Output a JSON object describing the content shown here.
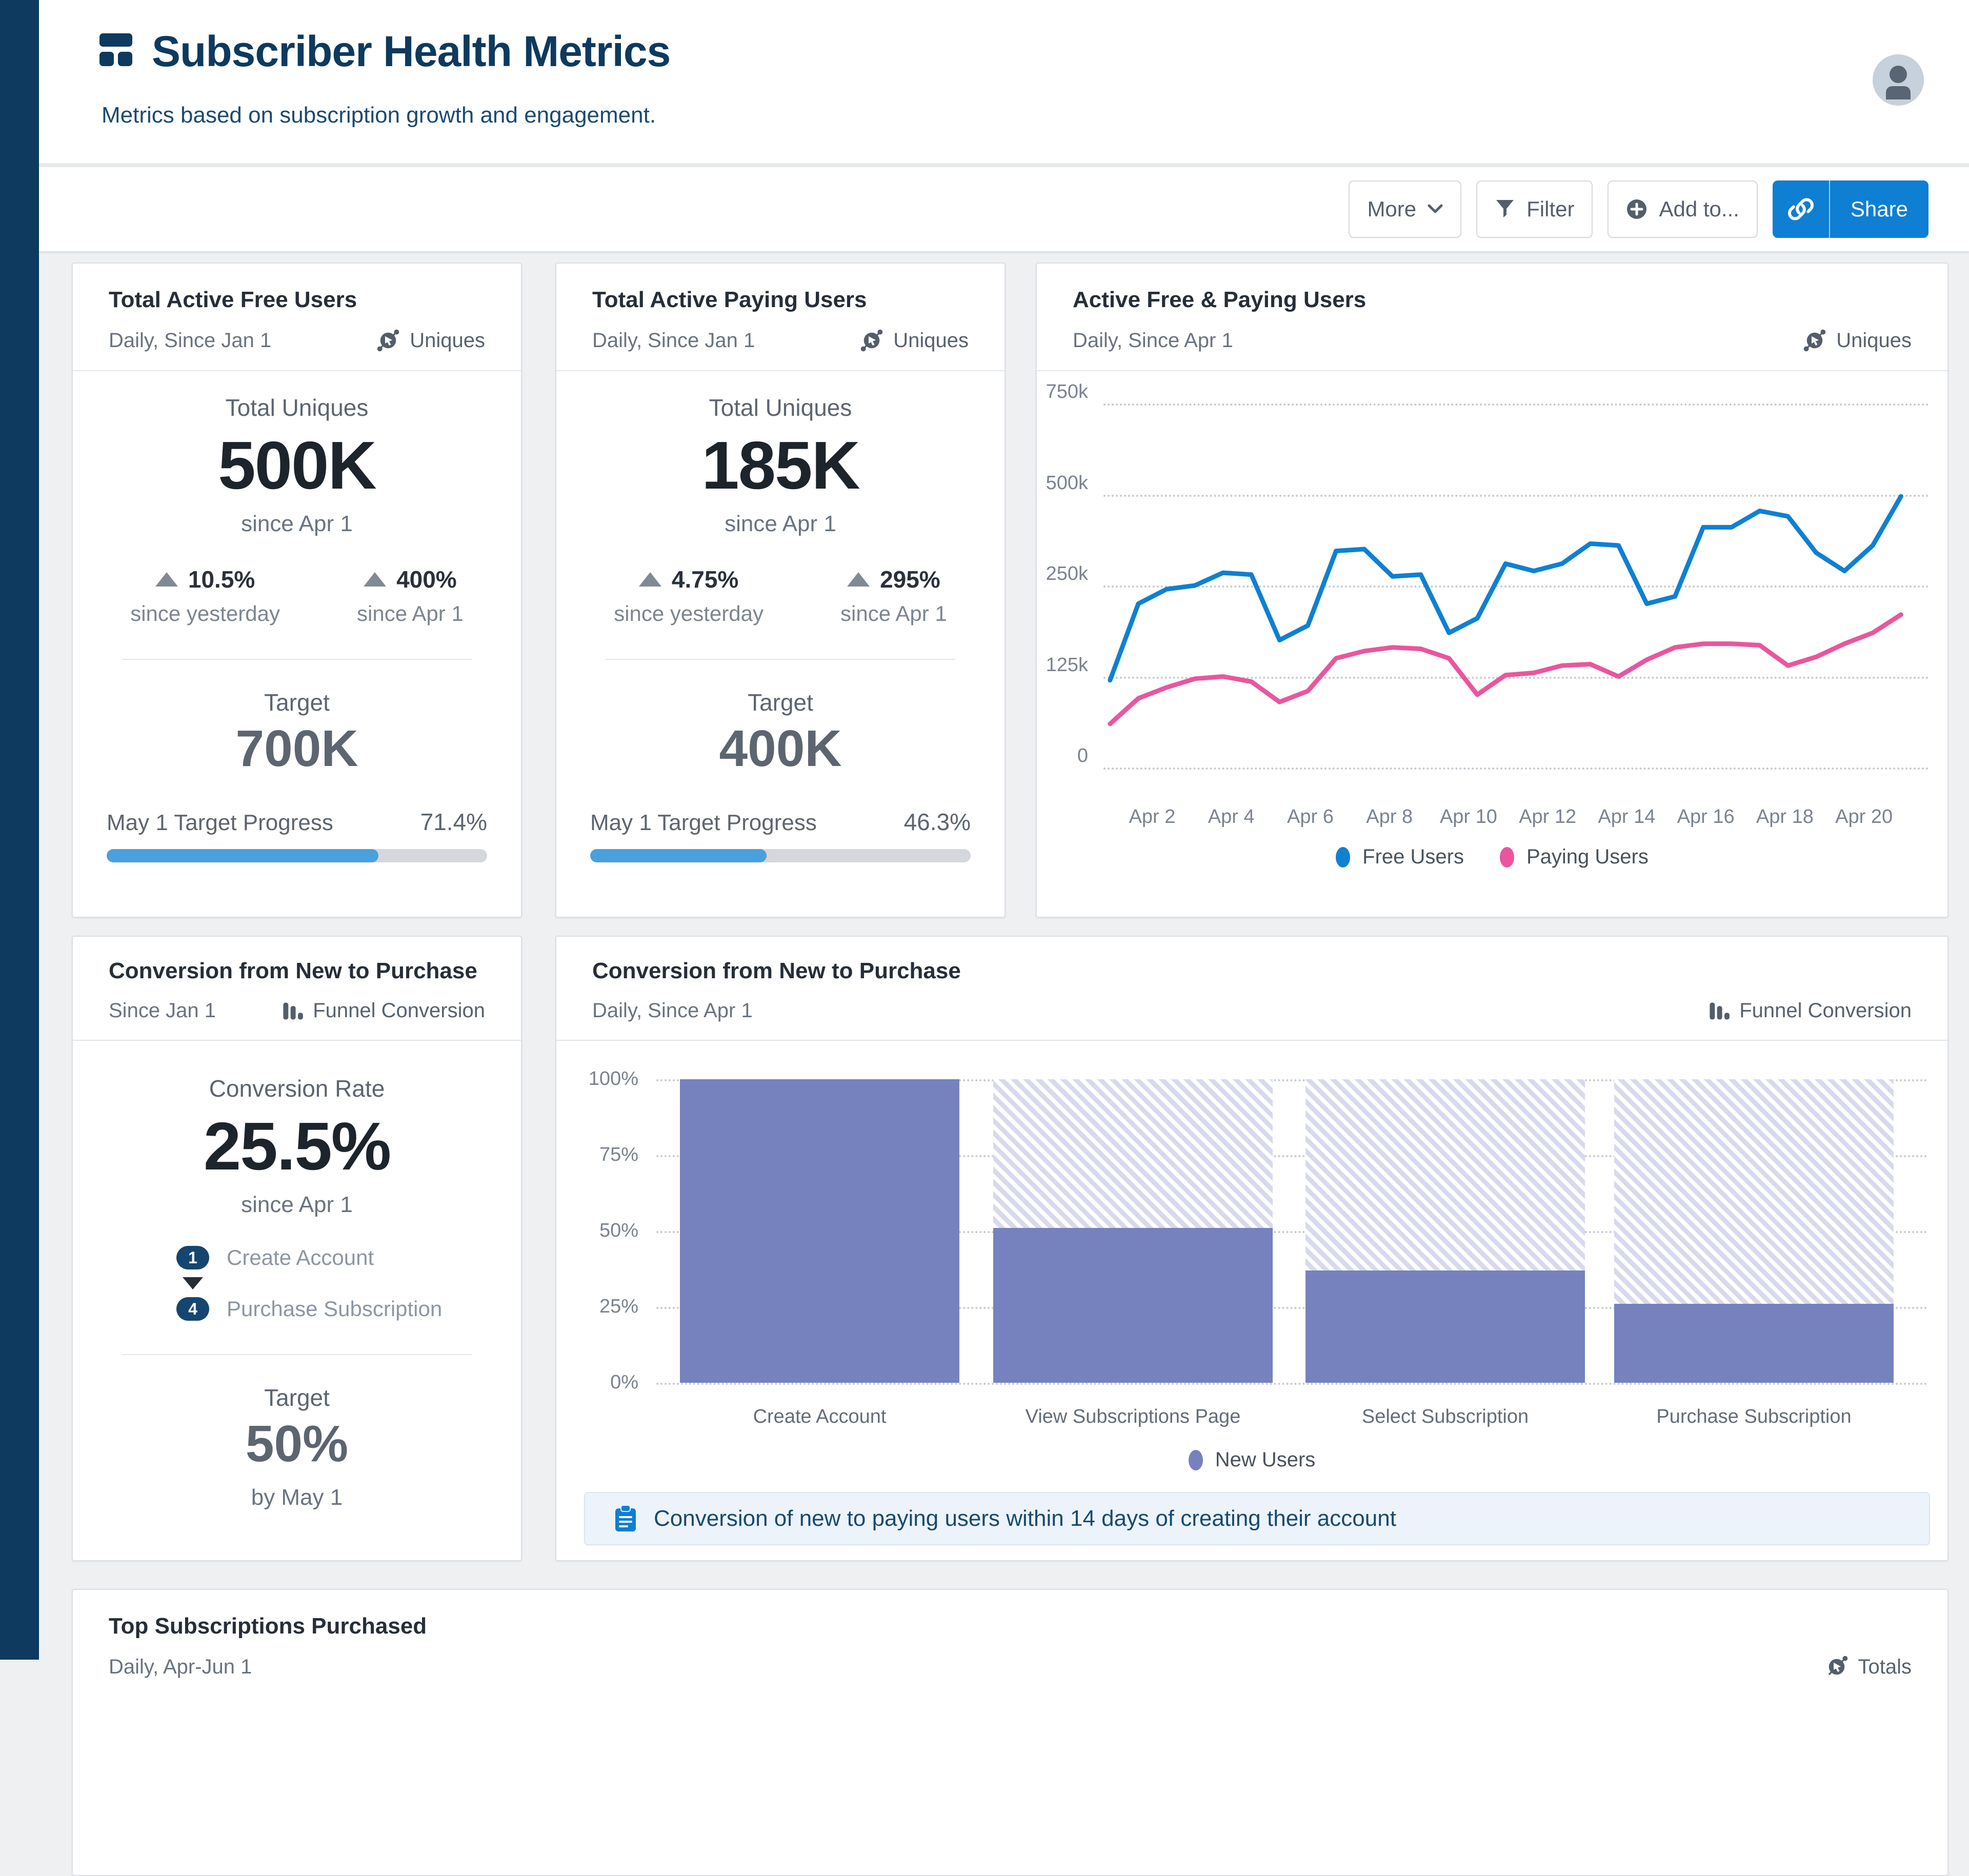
{
  "app": {
    "title": "Subscriber Health Metrics",
    "subtitle": "Metrics based on subscription growth and engagement."
  },
  "toolbar": {
    "more_label": "More",
    "filter_label": "Filter",
    "add_to_label": "Add to...",
    "share_label": "Share"
  },
  "colors": {
    "navy": "#0d3a5e",
    "accent_blue": "#0e7fd2",
    "progress_fill": "#4aa0dd",
    "line_blue": "#0f80d2",
    "line_pink": "#e9569e",
    "funnel_purple": "#7682bd"
  },
  "cards": {
    "free_users": {
      "title": "Total Active Free Users",
      "subtitle": "Daily, Since Jan 1",
      "badge": "Uniques",
      "metric_label": "Total Uniques",
      "metric_value": "500K",
      "metric_caption": "since Apr 1",
      "delta1": {
        "value": "10.5%",
        "label": "since yesterday"
      },
      "delta2": {
        "value": "400%",
        "label": "since Apr 1"
      },
      "target_label": "Target",
      "target_value": "700K",
      "progress_label": "May 1 Target Progress",
      "progress_value": "71.4%",
      "progress_pct": 71.4
    },
    "paying_users": {
      "title": "Total Active Paying Users",
      "subtitle": "Daily, Since Jan 1",
      "badge": "Uniques",
      "metric_label": "Total Uniques",
      "metric_value": "185K",
      "metric_caption": "since Apr 1",
      "delta1": {
        "value": "4.75%",
        "label": "since yesterday"
      },
      "delta2": {
        "value": "295%",
        "label": "since Apr 1"
      },
      "target_label": "Target",
      "target_value": "400K",
      "progress_label": "May 1 Target Progress",
      "progress_value": "46.3%",
      "progress_pct": 46.3
    },
    "line_chart": {
      "title": "Active Free & Paying Users",
      "subtitle": "Daily, Since Apr 1",
      "badge": "Uniques"
    },
    "conversion_summary": {
      "title": "Conversion from New to Purchase",
      "subtitle": "Since Jan 1",
      "badge": "Funnel Conversion",
      "metric_label": "Conversion Rate",
      "metric_value": "25.5%",
      "metric_caption": "since Apr 1",
      "step1": {
        "num": "1",
        "label": "Create Account"
      },
      "step2": {
        "num": "4",
        "label": "Purchase Subscription"
      },
      "target_label": "Target",
      "target_value": "50%",
      "target_caption": "by May 1"
    },
    "funnel_chart": {
      "title": "Conversion from New to Purchase",
      "subtitle": "Daily, Since Apr 1",
      "badge": "Funnel Conversion",
      "note": "Conversion of new to paying users within 14 days of creating their account"
    },
    "top_subscriptions": {
      "title": "Top Subscriptions Purchased",
      "subtitle": "Daily, Apr-Jun 1",
      "badge": "Totals"
    }
  },
  "chart_data": [
    {
      "type": "line",
      "title": "Active Free & Paying Users",
      "x_tick_labels": [
        "Apr 2",
        "Apr 4",
        "Apr 6",
        "Apr 8",
        "Apr 10",
        "Apr 12",
        "Apr 14",
        "Apr 16",
        "Apr 18",
        "Apr 20"
      ],
      "x_range": "Apr 1 - Apr 21, daily",
      "y_tick_labels": [
        "750k",
        "500k",
        "250k",
        "125k",
        "0"
      ],
      "y_tick_values_k": [
        750,
        500,
        250,
        125,
        0
      ],
      "y_axis_note": "ticks equally spaced (non-linear value scale)",
      "grid": "dotted horizontal gridlines",
      "legend_position": "bottom-center",
      "series": [
        {
          "name": "Free Users",
          "color": "#0f80d2",
          "unit": "users (thousands)",
          "values_k": [
            120,
            225,
            245,
            250,
            285,
            280,
            175,
            195,
            345,
            350,
            275,
            280,
            185,
            205,
            310,
            290,
            310,
            365,
            360,
            225,
            235,
            410,
            410,
            455,
            440,
            340,
            290,
            360,
            495
          ]
        },
        {
          "name": "Paying Users",
          "color": "#e9569e",
          "unit": "users (thousands)",
          "values_k": [
            60,
            95,
            110,
            122,
            125,
            118,
            90,
            105,
            150,
            160,
            165,
            163,
            150,
            100,
            127,
            130,
            140,
            142,
            125,
            148,
            165,
            170,
            170,
            168,
            140,
            152,
            170,
            185,
            210
          ]
        }
      ]
    },
    {
      "type": "bar",
      "title": "Conversion from New to Purchase",
      "categories": [
        "Create Account",
        "View Subscriptions Page",
        "Select Subscription",
        "Purchase Subscription"
      ],
      "values_pct": [
        100,
        51,
        37,
        26
      ],
      "series_name": "New Users",
      "bar_color": "#7682bd",
      "remainder_style": "hatched block up to 100%",
      "y_tick_labels": [
        "100%",
        "75%",
        "50%",
        "25%",
        "0%"
      ],
      "ylim": [
        0,
        100
      ],
      "legend_position": "bottom-center"
    }
  ]
}
